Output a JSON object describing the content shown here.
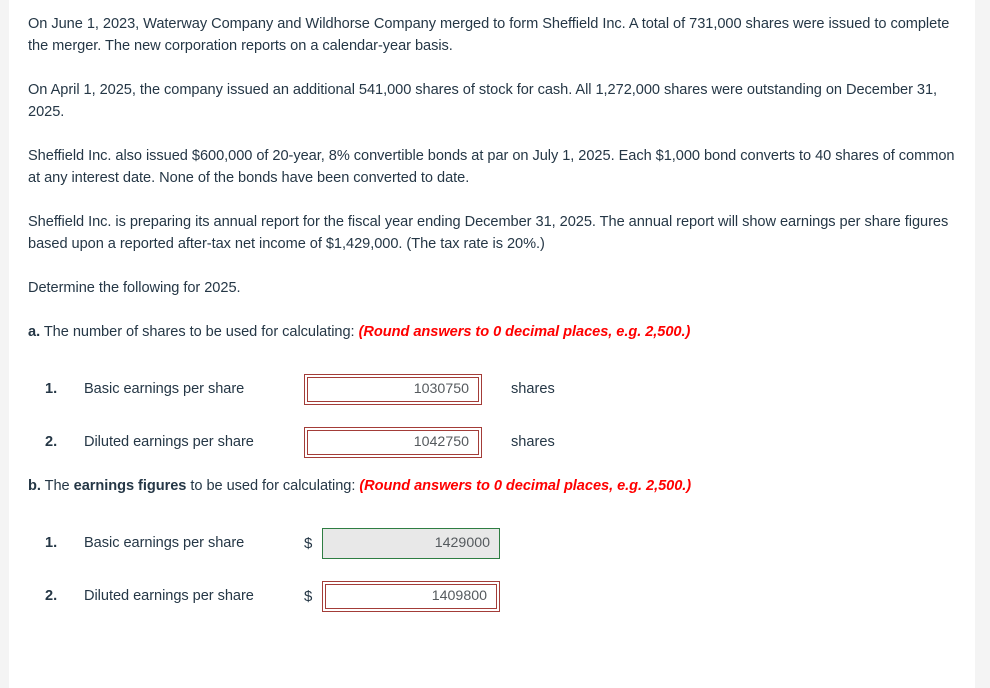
{
  "colors": {
    "text": "#253746",
    "note_red": "#ff0000",
    "field_border_red": "#a33c38",
    "field_border_green": "#2e7d42",
    "field_disabled_bg": "#e8e8e8",
    "page_bg": "#f4f4f4",
    "sheet_bg": "#ffffff"
  },
  "paragraphs": [
    "On June 1, 2023, Waterway Company and Wildhorse Company merged to form Sheffield Inc. A total of 731,000 shares were issued to complete the merger. The new corporation reports on a calendar-year basis.",
    "On April 1, 2025, the company issued an additional 541,000 shares of stock for cash. All 1,272,000 shares were outstanding on December 31, 2025.",
    "Sheffield Inc. also issued $600,000 of 20-year, 8% convertible bonds at par on July 1, 2025. Each $1,000 bond converts to 40 shares of common at any interest date. None of the bonds have been converted to date.",
    "Sheffield Inc. is preparing its annual report for the fiscal year ending December 31, 2025. The annual report will show earnings per share figures based upon a reported after-tax net income of $1,429,000. (The tax rate is 20%.)",
    "Determine the following for 2025."
  ],
  "section_a": {
    "letter": "a.",
    "lead": " The number of shares to be used for calculating: ",
    "note": "(Round answers to 0 decimal places, e.g. 2,500.)",
    "rows": [
      {
        "num": "1.",
        "label": "Basic earnings per share",
        "prefix": "",
        "value": "1030750",
        "suffix": "shares",
        "state": "red"
      },
      {
        "num": "2.",
        "label": "Diluted earnings per share",
        "prefix": "",
        "value": "1042750",
        "suffix": "shares",
        "state": "red"
      }
    ]
  },
  "section_b": {
    "letter": "b.",
    "lead_1": " The ",
    "lead_bold": "earnings figures",
    "lead_2": " to be used for calculating: ",
    "note": "(Round answers to 0 decimal places, e.g. 2,500.)",
    "rows": [
      {
        "num": "1.",
        "label": "Basic earnings per share",
        "prefix": "$",
        "value": "1429000",
        "suffix": "",
        "state": "green"
      },
      {
        "num": "2.",
        "label": "Diluted earnings per share",
        "prefix": "$",
        "value": "1409800",
        "suffix": "",
        "state": "red"
      }
    ]
  }
}
